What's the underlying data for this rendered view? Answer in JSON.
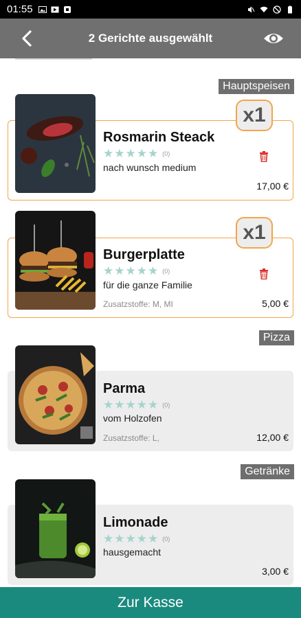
{
  "status_bar": {
    "time": "01:55"
  },
  "app_bar": {
    "title": "2 Gerichte ausgewählt"
  },
  "sections": {
    "main": "Hauptspeisen",
    "pizza": "Pizza",
    "drinks": "Getränke"
  },
  "dishes": [
    {
      "name": "Rosmarin Steack",
      "rating_count": "(0)",
      "description": "nach wunsch medium",
      "additives": "",
      "price": "17,00 €",
      "quantity": "x1",
      "selected": true
    },
    {
      "name": "Burgerplatte",
      "rating_count": "(0)",
      "description": "für die ganze Familie",
      "additives": "Zusatzstoffe: M, MI",
      "price": "5,00 €",
      "quantity": "x1",
      "selected": true
    },
    {
      "name": "Parma",
      "rating_count": "(0)",
      "description": "vom Holzofen",
      "additives": "Zusatzstoffe: L,",
      "price": "12,00 €",
      "quantity": "",
      "selected": false
    },
    {
      "name": "Limonade",
      "rating_count": "(0)",
      "description": "hausgemacht",
      "additives": "",
      "price": "3,00 €",
      "quantity": "",
      "selected": false
    }
  ],
  "checkout_button": {
    "label": "Zur Kasse"
  },
  "colors": {
    "accent": "#1b8a7e",
    "selected_border": "#f2a54a",
    "appbar": "#707070",
    "star": "#a5d4cc",
    "delete": "#d9302b"
  },
  "icons": [
    "back-arrow-icon",
    "eye-icon",
    "trash-icon",
    "star-icon"
  ]
}
